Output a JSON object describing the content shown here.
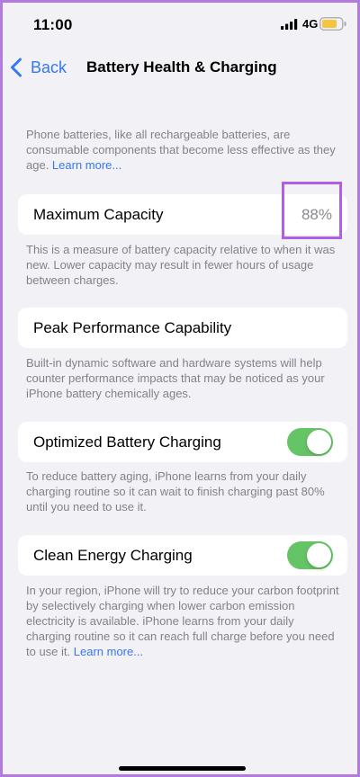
{
  "status_bar": {
    "time": "11:00",
    "network": "4G",
    "signal_icon": "cellular-signal-icon",
    "battery_icon": "battery-icon",
    "battery_color": "#f5c542"
  },
  "nav": {
    "back_label": "Back",
    "title": "Battery Health & Charging"
  },
  "intro": {
    "text": "Phone batteries, like all rechargeable batteries, are consumable components that become less effective as they age. ",
    "link": "Learn more..."
  },
  "max_capacity": {
    "label": "Maximum Capacity",
    "value": "88%",
    "note": "This is a measure of battery capacity relative to when it was new. Lower capacity may result in fewer hours of usage between charges."
  },
  "peak_performance": {
    "label": "Peak Performance Capability",
    "note": "Built-in dynamic software and hardware systems will help counter performance impacts that may be noticed as your iPhone battery chemically ages."
  },
  "optimized_charging": {
    "label": "Optimized Battery Charging",
    "enabled": true,
    "note": "To reduce battery aging, iPhone learns from your daily charging routine so it can wait to finish charging past 80% until you need to use it."
  },
  "clean_energy": {
    "label": "Clean Energy Charging",
    "enabled": true,
    "note": "In your region, iPhone will try to reduce your carbon footprint by selectively charging when lower carbon emission electricity is available. iPhone learns from your daily charging routine so it can reach full charge before you need to use it. ",
    "link": "Learn more..."
  },
  "colors": {
    "accent": "#3478f6",
    "toggle_on": "#65c466",
    "highlight": "#b15ee6"
  }
}
